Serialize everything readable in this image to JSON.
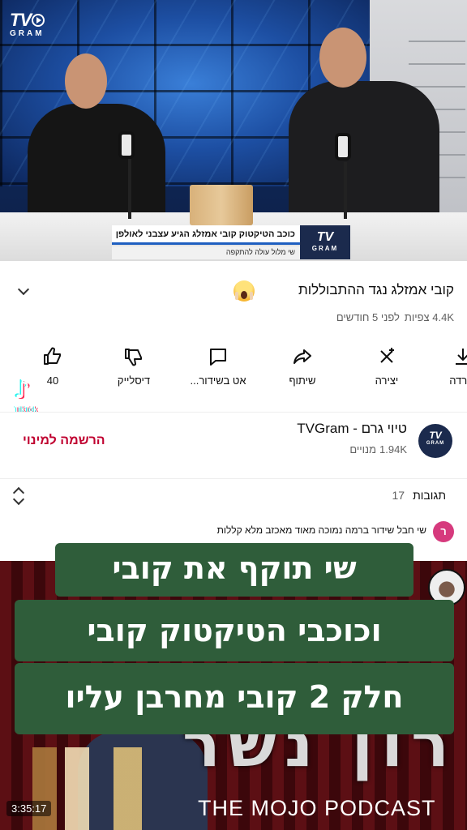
{
  "studio": {
    "logo_tv": "TV",
    "logo_gram": "GRAM",
    "lower_third_headline": "כוכב הטיקטוק קובי אמזלג הגיע עצבני לאולפן",
    "lower_third_sub": "שי מלול עולה להתקפה",
    "lower_third_logo_tv": "TV",
    "lower_third_logo_gram": "GRAM"
  },
  "video": {
    "title": "קובי אמזלג נגד ההתבוללות",
    "views": "4.4K צפיות",
    "age": "לפני 5 חודשים"
  },
  "actions": [
    {
      "label": "הורדה",
      "icon": "download-icon"
    },
    {
      "label": "יצירה",
      "icon": "create-icon"
    },
    {
      "label": "שיתוף",
      "icon": "share-icon"
    },
    {
      "label": "אט בשידור...",
      "icon": "live-chat-icon"
    },
    {
      "label": "דיסלייק",
      "icon": "dislike-icon"
    },
    {
      "label": "40",
      "icon": "like-icon"
    }
  ],
  "tiktok": {
    "word": "TikTok"
  },
  "channel": {
    "name": "טיוי גרם - TVGram",
    "subscribers": "1.94K",
    "subscribers_label": "מנויים",
    "subscribe_label": "הרשמה למינוי",
    "avatar_tv": "TV",
    "avatar_gram": "GRAM"
  },
  "comments": {
    "title": "תגובות",
    "count": "17",
    "first_avatar_letter": "ר",
    "first_text": "שי חבל שידור ברמה נמוכה מאוד מאכזב מלא קללות"
  },
  "caption": {
    "line1": "שי תוקף את קובי",
    "line2": "וכוכבי הטיקטוק קובי",
    "line3": "חלק 2 קובי מחרבן עליו"
  },
  "podcast": {
    "title": "רון נשר",
    "brand": "THE MOJO PODCAST"
  },
  "player": {
    "timestamp": "3:35:17"
  },
  "colors": {
    "caption_bg": "#2f5d3a",
    "subscribe_red": "#c00030",
    "comment_avatar": "#d63a7d",
    "channel_navy": "#1b2a4d"
  }
}
